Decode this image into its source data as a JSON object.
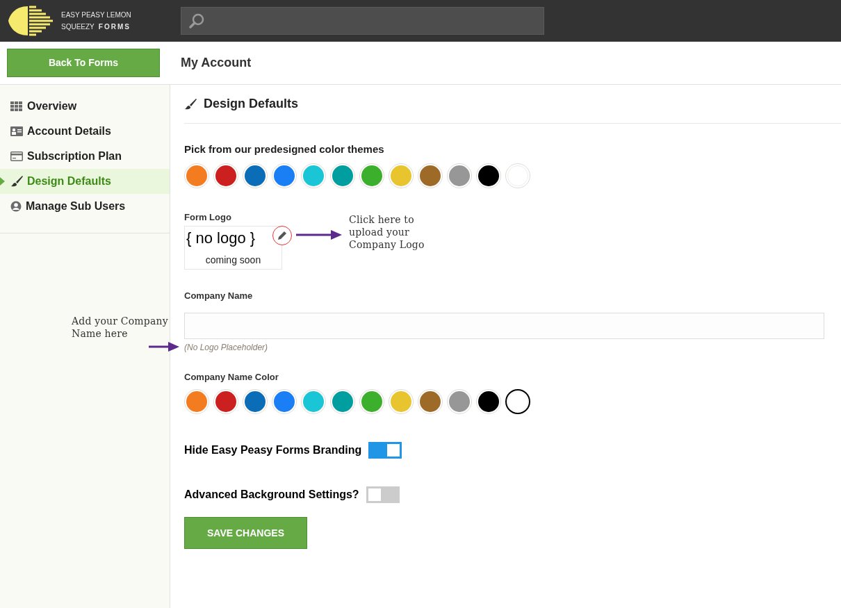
{
  "brand": {
    "line_1": "EASY PEASY LEMON",
    "line_2a": "SQUEEZY",
    "line_2b": "FORMS"
  },
  "back_button": "Back To Forms",
  "page_title": "My Account",
  "sidebar": {
    "items": [
      {
        "label": "Overview",
        "selected": false
      },
      {
        "label": "Account Details",
        "selected": false
      },
      {
        "label": "Subscription Plan",
        "selected": false
      },
      {
        "label": "Design Defaults",
        "selected": true
      },
      {
        "label": "Manage Sub Users",
        "selected": false
      }
    ]
  },
  "section_title": "Design Defaults",
  "theme_picker": {
    "label": "Pick from our predesigned color themes",
    "swatches": [
      {
        "color": "#f47c20",
        "selected": false
      },
      {
        "color": "#cc2020",
        "selected": false
      },
      {
        "color": "#0b6db7",
        "selected": false
      },
      {
        "color": "#1a7ef5",
        "selected": false
      },
      {
        "color": "#1ac6d6",
        "selected": false
      },
      {
        "color": "#009e9e",
        "selected": false
      },
      {
        "color": "#3cb02c",
        "selected": false
      },
      {
        "color": "#e8c52e",
        "selected": false
      },
      {
        "color": "#9e6a28",
        "selected": false
      },
      {
        "color": "#979797",
        "selected": false
      },
      {
        "color": "#000000",
        "selected": false
      },
      {
        "color": "#ffffff",
        "selected": false
      }
    ]
  },
  "form_logo": {
    "label": "Form Logo",
    "logo_text": "{ no logo }",
    "logo_subtext": "coming soon",
    "annotation": "Click here to upload your Company Logo"
  },
  "company_name": {
    "label": "Company Name",
    "hint": "(No Logo Placeholder)",
    "annotation": "Add your Company Name here"
  },
  "company_name_color": {
    "label": "Company Name Color",
    "swatches": [
      {
        "color": "#f47c20",
        "selected": false
      },
      {
        "color": "#cc2020",
        "selected": false
      },
      {
        "color": "#0b6db7",
        "selected": false
      },
      {
        "color": "#1a7ef5",
        "selected": false
      },
      {
        "color": "#1ac6d6",
        "selected": false
      },
      {
        "color": "#009e9e",
        "selected": false
      },
      {
        "color": "#3cb02c",
        "selected": false
      },
      {
        "color": "#e8c52e",
        "selected": false
      },
      {
        "color": "#9e6a28",
        "selected": false
      },
      {
        "color": "#979797",
        "selected": false
      },
      {
        "color": "#000000",
        "selected": false
      },
      {
        "color": "#ffffff",
        "selected": true
      }
    ]
  },
  "toggles": [
    {
      "label": "Hide Easy Peasy Forms Branding",
      "on": true
    },
    {
      "label": "Advanced Background Settings?",
      "on": false
    }
  ],
  "save_button": "SAVE CHANGES"
}
